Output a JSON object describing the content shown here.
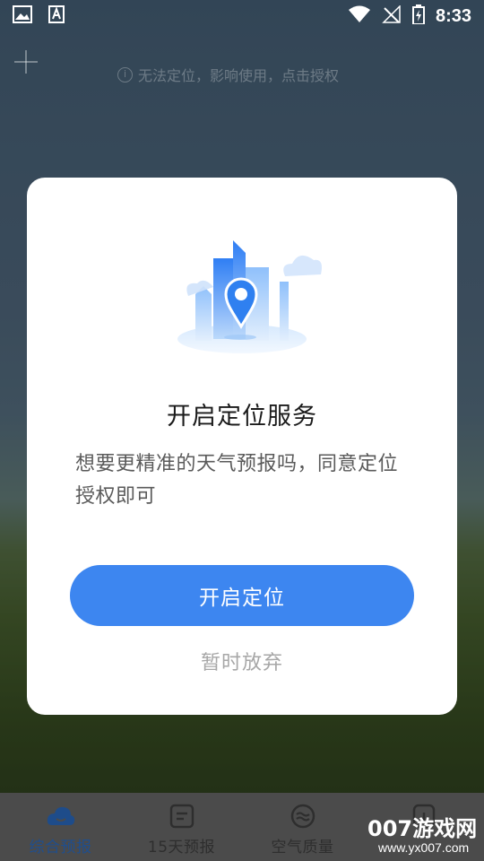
{
  "status_bar": {
    "time": "8:33",
    "left_icons": [
      "image-icon",
      "font-download-icon"
    ],
    "right_icons": [
      "wifi-icon",
      "no-signal-icon",
      "battery-charging-icon"
    ]
  },
  "header": {
    "add_icon": "plus-icon",
    "location_hint": "无法定位，影响使用，点击授权",
    "hint_icon": "info-icon"
  },
  "dialog": {
    "illustration": "location-city-illustration",
    "title": "开启定位服务",
    "description": "想要更精准的天气预报吗，同意定位授权即可",
    "primary_button": "开启定位",
    "secondary_button": "暂时放弃"
  },
  "bottom_nav": {
    "items": [
      {
        "label": "综合预报",
        "icon": "cloud-smile-icon",
        "active": true
      },
      {
        "label": "15天预报",
        "icon": "calendar-list-icon",
        "active": false
      },
      {
        "label": "空气质量",
        "icon": "air-quality-icon",
        "active": false
      },
      {
        "label": "",
        "icon": "info-icon",
        "active": false
      }
    ]
  },
  "watermark": {
    "main": "007游戏网",
    "sub": "www.yx007.com"
  },
  "colors": {
    "accent": "#3d86f0",
    "dialog_bg": "#ffffff",
    "nav_bg": "#4b4b4b",
    "active_nav": "#1f4e8e"
  }
}
